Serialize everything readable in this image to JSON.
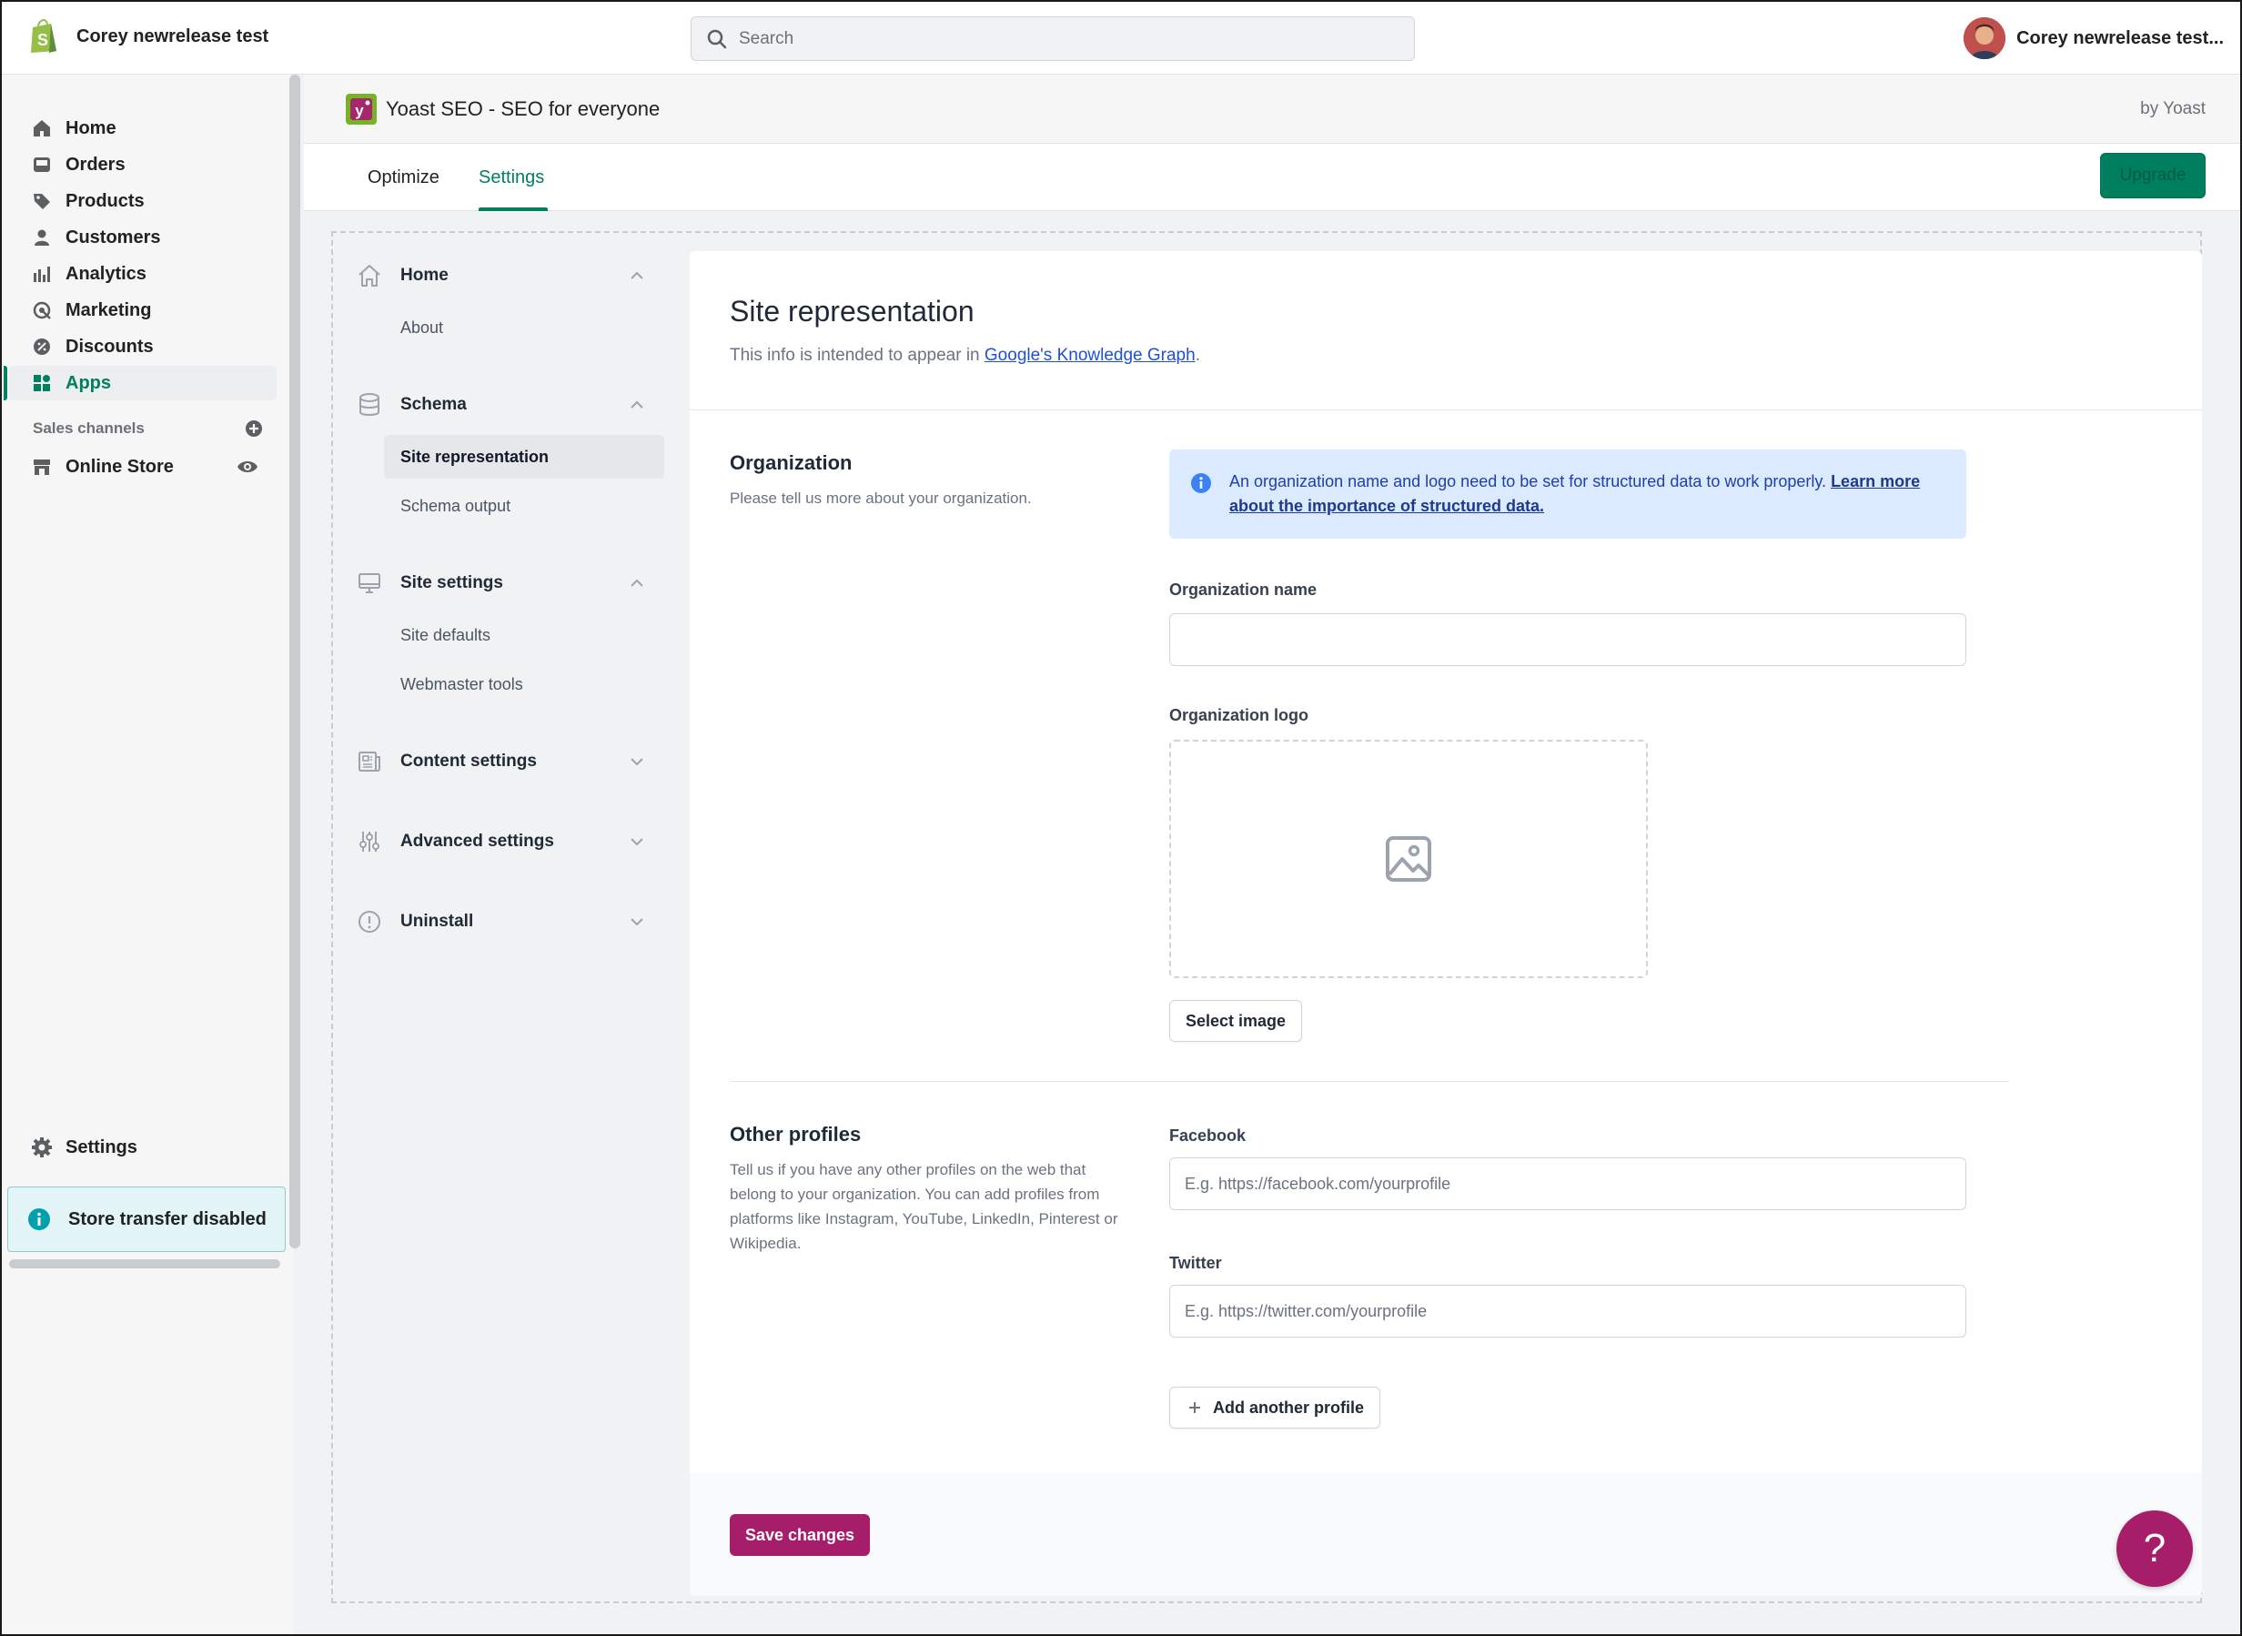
{
  "store": {
    "name": "Corey newrelease test"
  },
  "search": {
    "placeholder": "Search"
  },
  "user": {
    "name": "Corey newrelease test..."
  },
  "nav": {
    "items": [
      {
        "label": "Home",
        "icon": "home-icon"
      },
      {
        "label": "Orders",
        "icon": "orders-icon"
      },
      {
        "label": "Products",
        "icon": "tag-icon"
      },
      {
        "label": "Customers",
        "icon": "person-icon"
      },
      {
        "label": "Analytics",
        "icon": "bar-chart-icon"
      },
      {
        "label": "Marketing",
        "icon": "target-icon"
      },
      {
        "label": "Discounts",
        "icon": "discount-icon"
      },
      {
        "label": "Apps",
        "icon": "apps-icon"
      }
    ],
    "sales_channels_label": "Sales channels",
    "online_store_label": "Online Store",
    "settings_label": "Settings",
    "store_transfer_label": "Store transfer disabled"
  },
  "app": {
    "title": "Yoast SEO - SEO for everyone",
    "by": "by Yoast",
    "tabs": [
      {
        "label": "Optimize"
      },
      {
        "label": "Settings"
      }
    ],
    "upgrade_label": "Upgrade"
  },
  "yoast_menu": {
    "home": {
      "label": "Home",
      "sub": [
        "About"
      ]
    },
    "schema": {
      "label": "Schema",
      "sub": [
        "Site representation",
        "Schema output"
      ]
    },
    "site_settings": {
      "label": "Site settings",
      "sub": [
        "Site defaults",
        "Webmaster tools"
      ]
    },
    "content_settings": {
      "label": "Content settings"
    },
    "advanced_settings": {
      "label": "Advanced settings"
    },
    "uninstall": {
      "label": "Uninstall"
    }
  },
  "page": {
    "title": "Site representation",
    "intro_prefix": "This info is intended to appear in ",
    "intro_link": "Google's Knowledge Graph",
    "intro_suffix": ".",
    "organization": {
      "title": "Organization",
      "description": "Please tell us more about your organization.",
      "alert_text": "An organization name and logo need to be set for structured data to work properly. ",
      "alert_link": "Learn more about the importance of structured data.",
      "name_label": "Organization name",
      "name_value": "",
      "logo_label": "Organization logo",
      "select_image_label": "Select image"
    },
    "other_profiles": {
      "title": "Other profiles",
      "description": "Tell us if you have any other profiles on the web that belong to your organization. You can add profiles from platforms like Instagram, YouTube, LinkedIn, Pinterest or Wikipedia.",
      "facebook_label": "Facebook",
      "facebook_placeholder": "E.g. https://facebook.com/yourprofile",
      "twitter_label": "Twitter",
      "twitter_placeholder": "E.g. https://twitter.com/yourprofile",
      "add_profile_label": "Add another profile"
    },
    "save_label": "Save changes"
  },
  "help": {
    "label": "?"
  },
  "colors": {
    "shopify_green": "#008060",
    "yoast_purple": "#a61e69",
    "info_blue": "#dbeafe"
  }
}
